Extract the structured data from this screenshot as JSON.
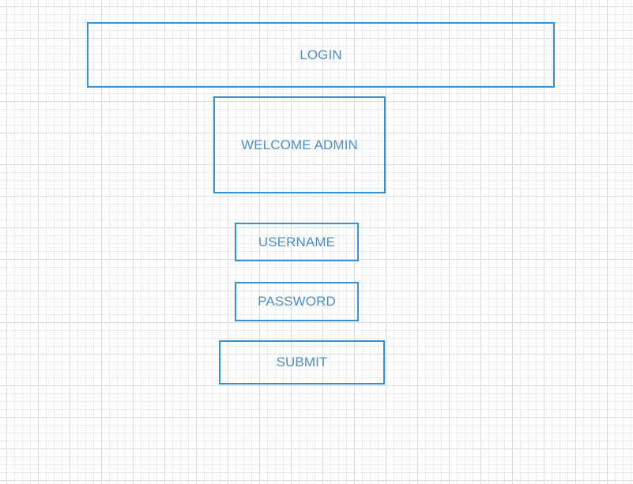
{
  "wireframe": {
    "title_box": {
      "label": "LOGIN"
    },
    "welcome_box": {
      "label": "WELCOME ADMIN"
    },
    "username_box": {
      "label": "USERNAME"
    },
    "password_box": {
      "label": "PASSWORD"
    },
    "submit_box": {
      "label": "SUBMIT"
    }
  },
  "colors": {
    "box_border": "#3a8fd0",
    "label_text": "#4f8fc0",
    "grid_major": "#d6dbe0",
    "grid_minor": "#e8ebee",
    "background": "#ffffff"
  }
}
